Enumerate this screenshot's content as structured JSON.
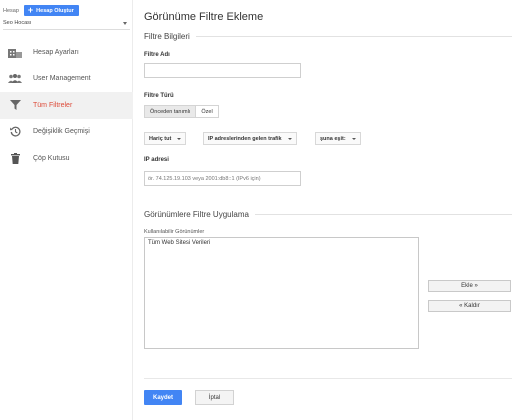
{
  "sidebar": {
    "account_label": "Hesap",
    "create_button_label": "Hesap Oluştur",
    "account_name": "Seo Hocası",
    "items": [
      {
        "label": "Hesap Ayarları",
        "icon": "account-settings-icon"
      },
      {
        "label": "User Management",
        "icon": "users-icon"
      },
      {
        "label": "Tüm Filtreler",
        "icon": "filter-icon",
        "active": true
      },
      {
        "label": "Değişiklik Geçmişi",
        "icon": "history-icon"
      },
      {
        "label": "Çöp Kutusu",
        "icon": "trash-icon"
      }
    ],
    "active_color": "#dd4b39"
  },
  "main": {
    "page_title": "Görünüme Filtre Ekleme",
    "filter_info_heading": "Filtre Bilgileri",
    "filter_name_label": "Filtre Adı",
    "filter_name_value": "",
    "filter_type_label": "Filtre Türü",
    "filter_type_options": [
      "Önceden tanımlı",
      "Özel"
    ],
    "filter_type_selected": "Önceden tanımlı",
    "dropdowns": {
      "action": "Hariç tut",
      "source": "IP adreslerinden gelen trafik",
      "condition": "şuna eşit:"
    },
    "ip_label": "IP adresi",
    "ip_placeholder": "ör. 74.125.19.103 veya 2001:db8::1 (IPv6 için)",
    "apply_heading": "Görünümlere Filtre Uygulama",
    "available_views_label": "Kullanılabilir Görünümler",
    "available_views": [
      "Tüm Web Sitesi Verileri"
    ],
    "add_button": "Ekle »",
    "remove_button": "« Kaldır",
    "save_button": "Kaydet",
    "cancel_button": "İptal"
  },
  "colors": {
    "primary": "#4285f4",
    "active_nav": "#dd4b39"
  }
}
